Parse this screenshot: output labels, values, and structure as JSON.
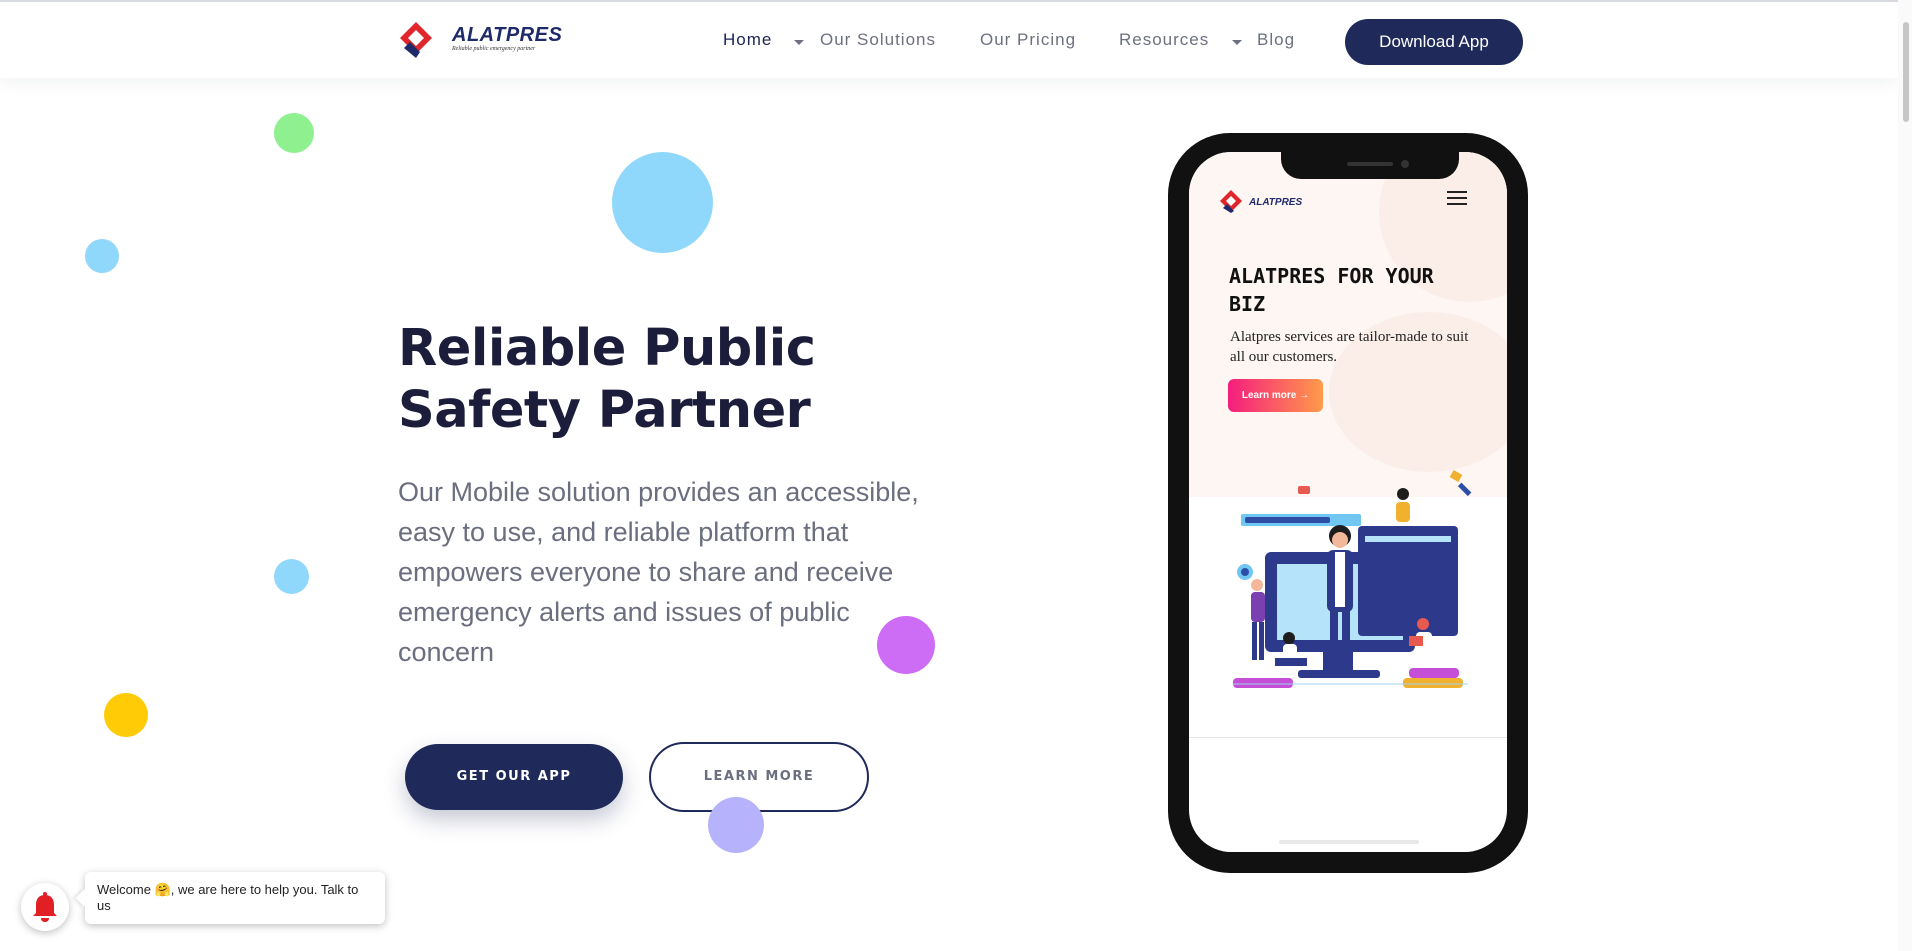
{
  "brand": {
    "name": "ALATPRES",
    "tagline": "Reliable public emergency partner",
    "colors": {
      "navy": "#1f2a5a",
      "logo_red": "#e0262b",
      "logo_navy": "#1f2a6b"
    }
  },
  "nav": {
    "items": [
      {
        "label": "Home",
        "active": true,
        "has_dropdown": true
      },
      {
        "label": "Our Solutions",
        "active": false,
        "has_dropdown": false
      },
      {
        "label": "Our Pricing",
        "active": false,
        "has_dropdown": false
      },
      {
        "label": "Resources",
        "active": false,
        "has_dropdown": true
      },
      {
        "label": "Blog",
        "active": false,
        "has_dropdown": false
      }
    ],
    "cta_label": "Download App"
  },
  "hero": {
    "title": "Reliable Public Safety Partner",
    "description": "Our Mobile solution provides an accessible, easy to use, and reliable platform that empowers everyone to share and receive emergency alerts and issues of public concern",
    "primary_button": "GET OUR APP",
    "secondary_button": "LEARN MORE"
  },
  "phone": {
    "brand": "ALATPRES",
    "title": "ALATPRES FOR YOUR BIZ",
    "description": "Alatpres services are tailor-made to suit all our customers.",
    "button_label": "Learn more →"
  },
  "chat": {
    "message": "Welcome 🤗, we are here to help you. Talk to us",
    "icon": "bell-icon"
  },
  "decor_colors": [
    "#8ef08f",
    "#90d8fb",
    "#fecb06",
    "#cd6cf5",
    "#b6b2fb"
  ]
}
